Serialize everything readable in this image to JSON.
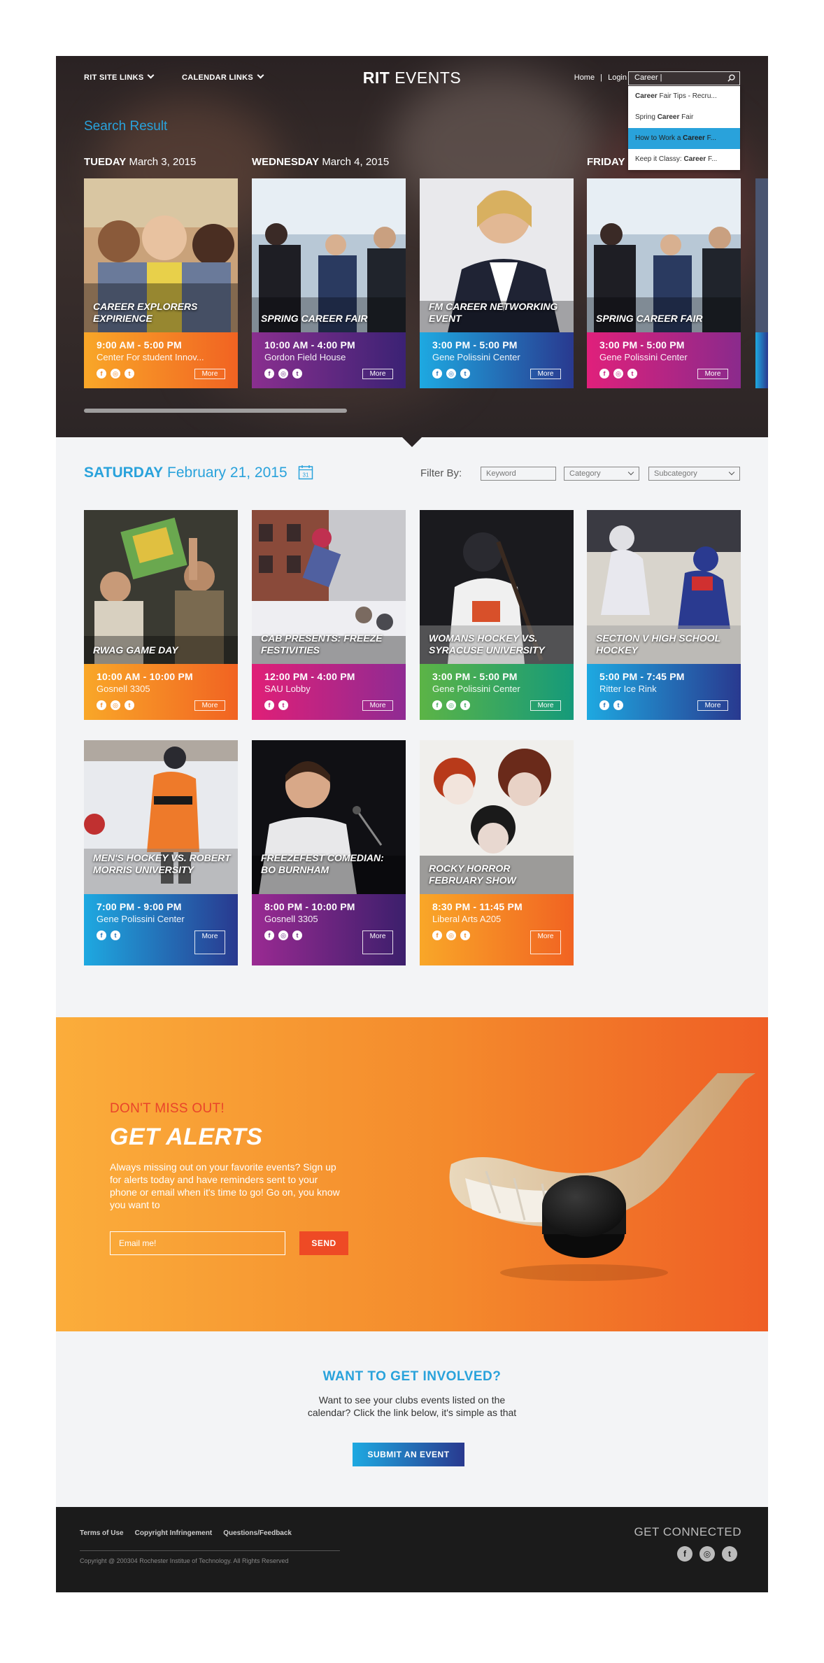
{
  "nav": {
    "site_links": "RIT SITE LINKS",
    "calendar_links": "CALENDAR LINKS",
    "brand_bold": "RIT",
    "brand_rest": "EVENTS",
    "home": "Home",
    "separator": "|",
    "login": "Login",
    "search_value": "Career |"
  },
  "search_suggestions": [
    {
      "bold": "Career",
      "rest": " Fair Tips - Recru..."
    },
    {
      "pre": "Spring ",
      "bold": "Career",
      "rest": " Fair"
    },
    {
      "pre": "How to Work a ",
      "bold": "Career",
      "rest": " F..."
    },
    {
      "pre": "Keep it Classy: ",
      "bold": "Career",
      "rest": " F..."
    }
  ],
  "search_result_title": "Search Result",
  "day_labels": [
    {
      "day": "TUEDAY",
      "date": "March 3, 2015"
    },
    {
      "day": "WEDNESDAY",
      "date": "March 4, 2015"
    },
    {
      "day": "FRIDAY",
      "date": ""
    }
  ],
  "search_cards": [
    {
      "title": "Career Explorers Expirience",
      "time": "9:00 AM - 5:00 PM",
      "location": "Center For student Innov...",
      "more": "More"
    },
    {
      "title": "Spring Career Fair",
      "time": "10:00 AM - 4:00 PM",
      "location": "Gordon Field House",
      "more": "More"
    },
    {
      "title": "FM Career Networking Event",
      "time": "3:00 PM - 5:00 PM",
      "location": "Gene Polissini Center",
      "more": "More"
    },
    {
      "title": "Spring Career Fair",
      "time": "3:00 PM - 5:00 PM",
      "location": "Gene Polissini Center",
      "more": "More"
    }
  ],
  "listing": {
    "day": "SATURDAY",
    "date": "February 21, 2015",
    "calendar_day": "31",
    "filter_label": "Filter By:",
    "keyword_placeholder": "Keyword",
    "category": "Category",
    "subcategory": "Subcategory"
  },
  "events": [
    {
      "title": "RWAG Game Day",
      "time": "10:00 AM - 10:00 PM",
      "location": "Gosnell 3305",
      "more": "More"
    },
    {
      "title": "CAB Presents: Freeze Festivities",
      "time": "12:00 PM - 4:00 PM",
      "location": "SAU Lobby",
      "more": "More"
    },
    {
      "title": "Womans Hockey vs. Syracuse University",
      "time": "3:00 PM - 5:00 PM",
      "location": "Gene Polissini Center",
      "more": "More"
    },
    {
      "title": "Section V High School Hockey",
      "time": "5:00 PM - 7:45 PM",
      "location": "Ritter Ice Rink",
      "more": "More"
    },
    {
      "title": "Men's Hockey vs. Robert Morris University",
      "time": "7:00 PM - 9:00 PM",
      "location": "Gene Polissini Center",
      "more": "More"
    },
    {
      "title": "FreezeFest Comedian: Bo Burnham",
      "time": "8:00 PM - 10:00 PM",
      "location": "Gosnell 3305",
      "more": "More"
    },
    {
      "title": "Rocky Horror February Show",
      "time": "8:30 PM - 11:45 PM",
      "location": "Liberal Arts A205",
      "more": "More"
    }
  ],
  "alerts": {
    "kicker": "DON'T MISS OUT!",
    "title": "GET ALERTS",
    "description": "Always missing out on your favorite events? Sign up for alerts today and have reminders sent to your phone or email when it's time to go! Go on, you know you want to",
    "email_placeholder": "Email me!",
    "send": "SEND"
  },
  "involved": {
    "title": "WANT TO GET INVOLVED?",
    "line1": "Want to see your clubs events listed on the",
    "line2": "calendar? Click the link below, it's simple as that",
    "button": "SUBMIT AN EVENT"
  },
  "footer": {
    "links": [
      "Terms of Use",
      "Copyright Infringement",
      "Questions/Feedback"
    ],
    "copyright": "Copyright @ 200304 Rochester Institue of Technology. All Rights Reserved",
    "connected": "GET CONNECTED",
    "social_icons": [
      "facebook-icon",
      "instagram-icon",
      "twitter-icon"
    ]
  },
  "colors": {
    "accent_blue": "#29a2db",
    "orange": "#f16322",
    "footer_bg": "#1b1b1b"
  }
}
